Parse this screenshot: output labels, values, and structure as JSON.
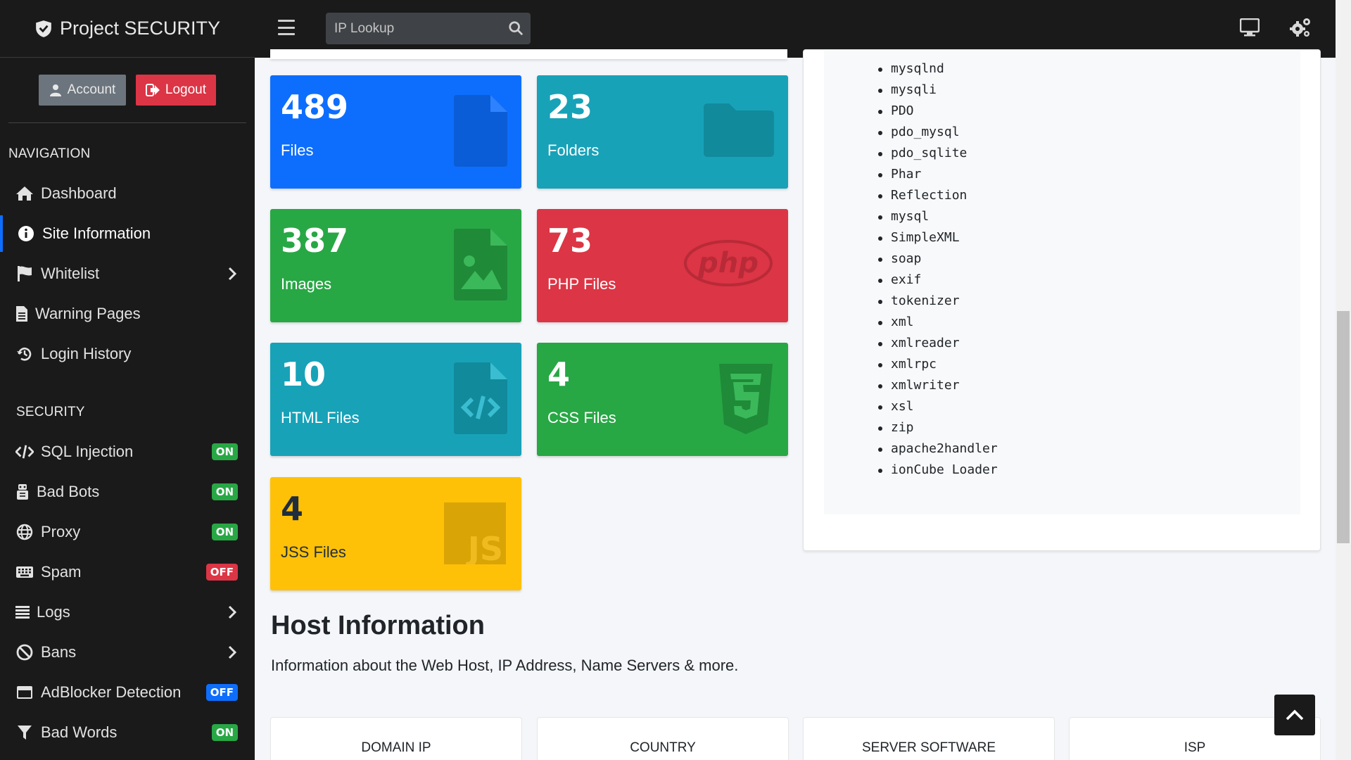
{
  "brand": {
    "name": "Project SECURITY",
    "icon": "shield-icon"
  },
  "search": {
    "placeholder": "IP Lookup",
    "icon": "search-icon"
  },
  "topbar": {
    "icons": [
      "monitor-icon",
      "gears-icon",
      "hamburger-icon"
    ]
  },
  "account": {
    "account_label": "Account",
    "logout_label": "Logout"
  },
  "sidebar": {
    "navigation_heading": "NAVIGATION",
    "security_heading": "SECURITY",
    "nav_items": [
      {
        "label": "Dashboard",
        "icon": "home-icon"
      },
      {
        "label": "Site Information",
        "icon": "info-circle-icon",
        "active": true
      },
      {
        "label": "Whitelist",
        "icon": "flag-icon",
        "has_submenu": true
      },
      {
        "label": "Warning Pages",
        "icon": "file-text-icon"
      },
      {
        "label": "Login History",
        "icon": "history-icon"
      }
    ],
    "security_items": [
      {
        "label": "SQL Injection",
        "icon": "code-icon",
        "status": "ON"
      },
      {
        "label": "Bad Bots",
        "icon": "robot-icon",
        "status": "ON"
      },
      {
        "label": "Proxy",
        "icon": "globe-icon",
        "status": "ON"
      },
      {
        "label": "Spam",
        "icon": "keyboard-icon",
        "status": "OFF"
      },
      {
        "label": "Logs",
        "icon": "list-icon",
        "has_submenu": true
      },
      {
        "label": "Bans",
        "icon": "ban-icon",
        "has_submenu": true
      },
      {
        "label": "AdBlocker Detection",
        "icon": "window-icon",
        "status": "OFF"
      },
      {
        "label": "Bad Words",
        "icon": "filter-icon",
        "status": "ON"
      }
    ]
  },
  "tiles": [
    {
      "count": "489",
      "label": "Files",
      "color": "#0d6efd",
      "icon": "file-icon"
    },
    {
      "count": "23",
      "label": "Folders",
      "color": "#17a2b8",
      "icon": "folder-icon"
    },
    {
      "count": "387",
      "label": "Images",
      "color": "#28a745",
      "icon": "image-file-icon"
    },
    {
      "count": "73",
      "label": "PHP Files",
      "color": "#dc3545",
      "icon": "php-icon"
    },
    {
      "count": "10",
      "label": "HTML Files",
      "color": "#17a2b8",
      "icon": "code-file-icon"
    },
    {
      "count": "4",
      "label": "CSS Files",
      "color": "#28a745",
      "icon": "css3-icon"
    },
    {
      "count": "4",
      "label": "JSS Files",
      "color": "#ffc107",
      "icon": "js-icon"
    }
  ],
  "extensions": [
    "mysqlnd",
    "mysqli",
    "PDO",
    "pdo_mysql",
    "pdo_sqlite",
    "Phar",
    "Reflection",
    "mysql",
    "SimpleXML",
    "soap",
    "exif",
    "tokenizer",
    "xml",
    "xmlreader",
    "xmlrpc",
    "xmlwriter",
    "xsl",
    "zip",
    "apache2handler",
    "ionCube Loader"
  ],
  "host": {
    "title": "Host Information",
    "subtitle": "Information about the Web Host, IP Address, Name Servers & more.",
    "cards": [
      "DOMAIN IP",
      "COUNTRY",
      "SERVER SOFTWARE",
      "ISP"
    ]
  }
}
